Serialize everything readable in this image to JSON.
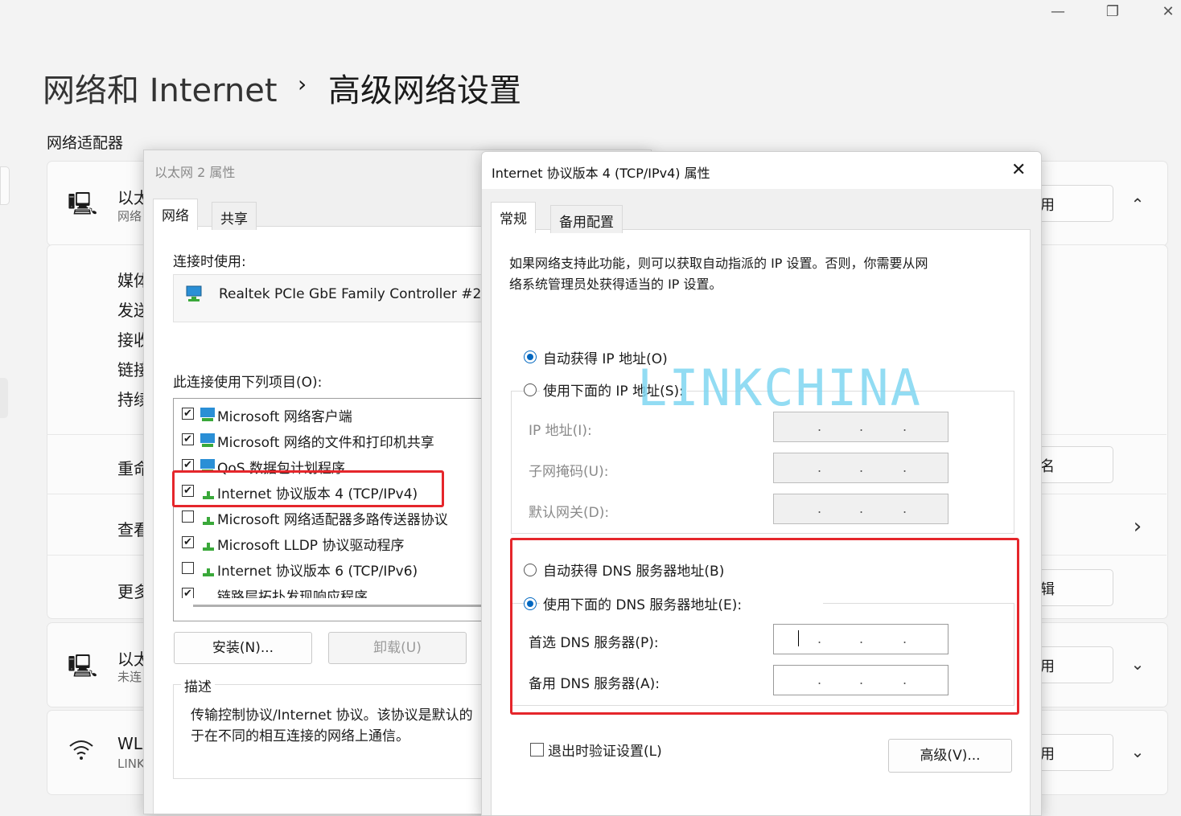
{
  "window": {
    "minimize_icon": "—",
    "restore_icon": "❐",
    "close_icon": "✕"
  },
  "breadcrumb": {
    "parent": "网络和 Internet",
    "separator": "›",
    "current": "高级网络设置"
  },
  "section_title": "网络适配器",
  "bg_adapter1": {
    "name": "以太",
    "sub": "网络",
    "button": "用",
    "chev": "⌃"
  },
  "bg_props": {
    "p1": "媒体",
    "p2": "发送",
    "p3": "接收",
    "p4": "链接",
    "p5": "持续"
  },
  "bg_rows": {
    "rename_label": "重命",
    "rename_btn": "名",
    "view_label": "查看",
    "view_chev": "›",
    "more_label": "更多",
    "more_btn": "辑"
  },
  "bg_adapter2": {
    "name": "以太",
    "sub": "未连",
    "button": "用",
    "chev": "⌄"
  },
  "bg_adapter3": {
    "name": "WLA",
    "sub": "LINK",
    "button": "用",
    "chev": "⌄"
  },
  "eth_dialog": {
    "title": "以太网 2 属性",
    "tabs": [
      "网络",
      "共享"
    ],
    "connect_using_label": "连接时使用:",
    "adapter_name": "Realtek PCIe GbE Family Controller #2",
    "items_label": "此连接使用下列项目(O):",
    "items": [
      {
        "label": "Microsoft 网络客户端",
        "checked": "✔"
      },
      {
        "label": "Microsoft 网络的文件和打印机共享",
        "checked": "✔"
      },
      {
        "label": "QoS 数据包计划程序",
        "checked": "✔"
      },
      {
        "label": "Internet 协议版本 4 (TCP/IPv4)",
        "checked": "✔"
      },
      {
        "label": "Microsoft 网络适配器多路传送器协议",
        "checked": ""
      },
      {
        "label": "Microsoft LLDP 协议驱动程序",
        "checked": "✔"
      },
      {
        "label": "Internet 协议版本 6 (TCP/IPv6)",
        "checked": ""
      },
      {
        "label": "链路层拓扑发现响应程序",
        "checked": "✔"
      }
    ],
    "install_btn": "安装(N)...",
    "uninstall_btn": "卸载(U)",
    "desc_label": "描述",
    "desc_line1": "传输控制协议/Internet 协议。该协议是默认的",
    "desc_line2": "于在不同的相互连接的网络上通信。"
  },
  "ipv4_dialog": {
    "title": "Internet 协议版本 4 (TCP/IPv4) 属性",
    "close_icon": "✕",
    "tabs": [
      "常规",
      "备用配置"
    ],
    "intro_line1": "如果网络支持此功能，则可以获取自动指派的 IP 设置。否则，你需要从网",
    "intro_line2": "络系统管理员处获得适当的 IP 设置。",
    "auto_ip": "自动获得 IP 地址(O)",
    "manual_ip": "使用下面的 IP 地址(S):",
    "ip_label": "IP 地址(I):",
    "mask_label": "子网掩码(U):",
    "gateway_label": "默认网关(D):",
    "auto_dns": "自动获得 DNS 服务器地址(B)",
    "manual_dns": "使用下面的 DNS 服务器地址(E):",
    "pref_dns_label": "首选 DNS 服务器(P):",
    "alt_dns_label": "备用 DNS 服务器(A):",
    "ip_dot": ".",
    "validate_label": "退出时验证设置(L)",
    "advanced_btn": "高级(V)..."
  },
  "watermark": "LINKCHINA"
}
